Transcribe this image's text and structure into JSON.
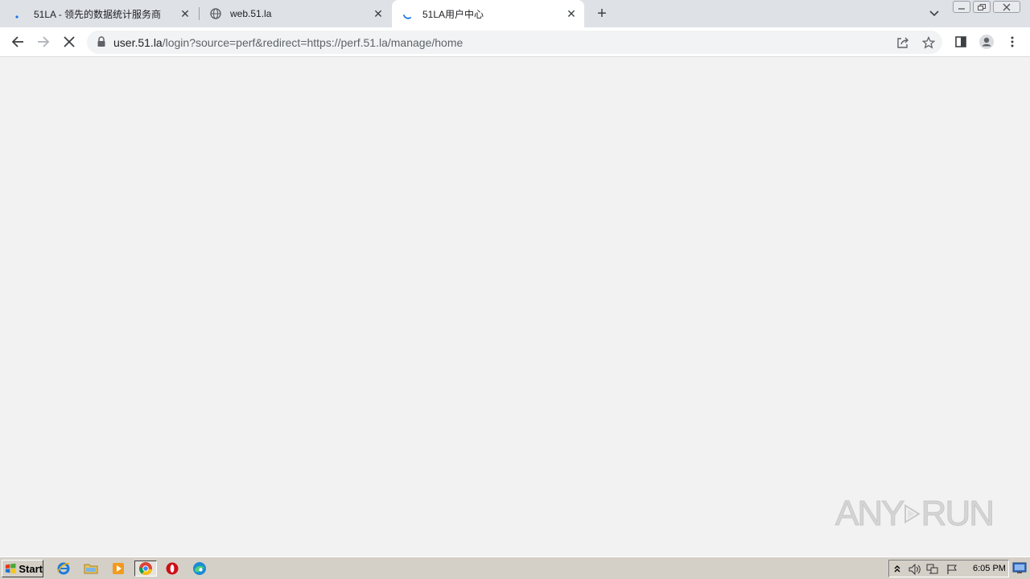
{
  "browser": {
    "tabs": [
      {
        "title": "51LA - 领先的数据统计服务商",
        "favicon": "dot-favicon",
        "active": false
      },
      {
        "title": "web.51.la",
        "favicon": "globe-icon",
        "active": false
      },
      {
        "title": "51LA用户中心",
        "favicon": "loading-spinner-icon",
        "active": true
      }
    ],
    "new_tab_label": "+",
    "address": {
      "host": "user.51.la",
      "path": "/login?source=perf&redirect=https://perf.51.la/manage/home"
    }
  },
  "page": {
    "watermark": {
      "left": "ANY",
      "right": "RUN"
    }
  },
  "taskbar": {
    "start_label": "Start",
    "clock": "6:05 PM",
    "quick_launch": [
      "ie-icon",
      "folder-icon",
      "media-player-icon",
      "chrome-icon",
      "opera-icon",
      "edge-icon"
    ],
    "tray": [
      "chevron-up-icon",
      "speaker-icon",
      "network-icon",
      "flag-icon"
    ]
  },
  "colors": {
    "tab_strip": "#dee1e6",
    "active_tab": "#ffffff",
    "page_bg": "#f2f2f2",
    "taskbar": "#d4d0c8",
    "spinner": "#1a73e8"
  }
}
